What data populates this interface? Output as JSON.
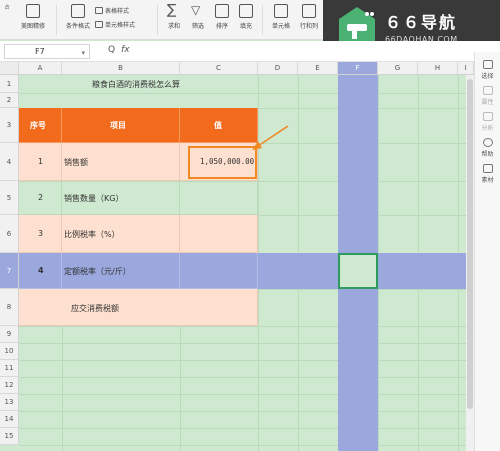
{
  "ribbon": {
    "items": [
      {
        "label": "美图精修"
      },
      {
        "label": "条件格式"
      },
      {
        "label": "表格样式",
        "label2": "单元格样式"
      },
      {
        "label": "求和"
      },
      {
        "label": "筛选"
      },
      {
        "label": "排序"
      },
      {
        "label": "填充"
      },
      {
        "label": "单元格"
      },
      {
        "label": "行和列"
      }
    ]
  },
  "logo": {
    "main": "６６导航",
    "sub": "66DAOHAN.COM"
  },
  "formula_bar": {
    "name_box": "F7",
    "fx": "fx",
    "zoom": "Q"
  },
  "right_panel": {
    "items": [
      {
        "label": "选择",
        "dim": false
      },
      {
        "label": "属性",
        "dim": true
      },
      {
        "label": "分析",
        "dim": true
      },
      {
        "label": "帮助",
        "dim": false
      },
      {
        "label": "素材",
        "dim": false
      }
    ]
  },
  "sheet": {
    "columns": [
      "A",
      "B",
      "C",
      "D",
      "E",
      "F",
      "G",
      "H",
      "I"
    ],
    "rows": [
      "1",
      "2",
      "3",
      "4",
      "5",
      "6",
      "7",
      "8",
      "9",
      "10",
      "11",
      "12",
      "13",
      "14",
      "15"
    ],
    "title": "粮食白酒的消费税怎么算",
    "header": {
      "seq": "序号",
      "item": "项目",
      "value": "值"
    },
    "data": [
      {
        "seq": "1",
        "item": "销售额",
        "value": "1,050,000.00"
      },
      {
        "seq": "2",
        "item": "销售数量（KG）",
        "value": ""
      },
      {
        "seq": "3",
        "item": "比例税率（%）",
        "value": ""
      },
      {
        "seq": "4",
        "item": "定额税率（元/斤）",
        "value": ""
      }
    ],
    "total_label": "应交消费税额",
    "active_cell": "F7"
  },
  "colors": {
    "header_orange": "#f26b1d",
    "data_peach": "#fde0cf",
    "row_highlight": "#9aa8de",
    "col_highlight": "#9aa8de",
    "sheet_green": "#cfe8d0",
    "annotation": "#f08a24"
  }
}
